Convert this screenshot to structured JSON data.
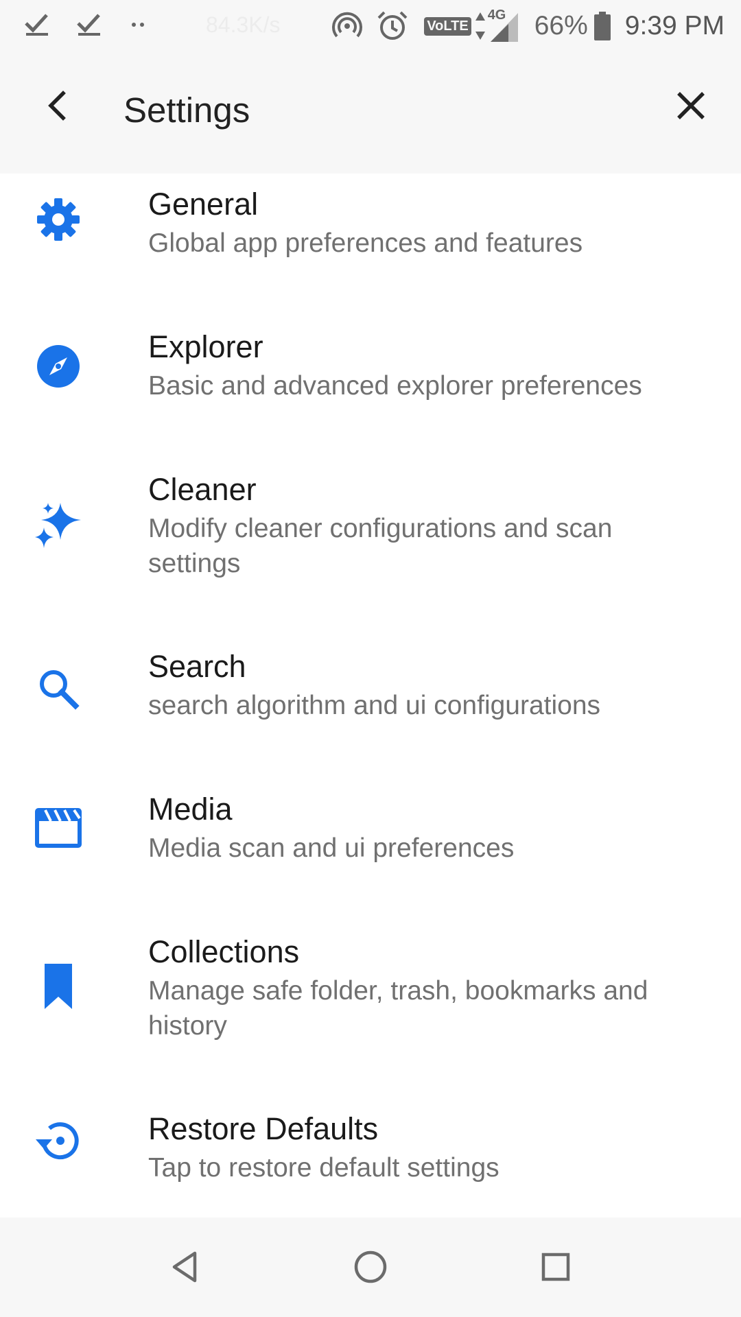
{
  "status_bar": {
    "net_speed": "84.3K/s",
    "network_type": "4G",
    "volte": "VoLTE",
    "battery": "66%",
    "time": "9:39 PM",
    "icons": [
      "check-icon",
      "check-icon",
      "more-dots-icon",
      "hotspot-icon",
      "alarm-icon",
      "volte-icon",
      "signal-icon",
      "battery-icon"
    ]
  },
  "app_bar": {
    "title": "Settings",
    "back_icon": "chevron-left-icon",
    "close_icon": "close-icon"
  },
  "settings_items": [
    {
      "title": "General",
      "subtitle": "Global app preferences and features",
      "icon": "gear-icon"
    },
    {
      "title": "Explorer",
      "subtitle": "Basic and advanced explorer preferences",
      "icon": "compass-icon"
    },
    {
      "title": "Cleaner",
      "subtitle": "Modify cleaner configurations and scan settings",
      "icon": "sparkle-icon"
    },
    {
      "title": "Search",
      "subtitle": "search algorithm and ui configurations",
      "icon": "search-icon"
    },
    {
      "title": "Media",
      "subtitle": "Media scan and ui preferences",
      "icon": "clapperboard-icon"
    },
    {
      "title": "Collections",
      "subtitle": "Manage safe folder, trash, bookmarks and history",
      "icon": "bookmark-icon"
    },
    {
      "title": "Restore Defaults",
      "subtitle": "Tap to restore default settings",
      "icon": "restore-icon"
    }
  ],
  "nav_bar": {
    "icons": [
      "back-triangle-icon",
      "home-circle-icon",
      "recents-square-icon"
    ]
  },
  "colors": {
    "accent": "#1a73e8",
    "title_text": "#1a1a1a",
    "subtitle_text": "#707070",
    "bar_bg": "#f7f7f7"
  }
}
